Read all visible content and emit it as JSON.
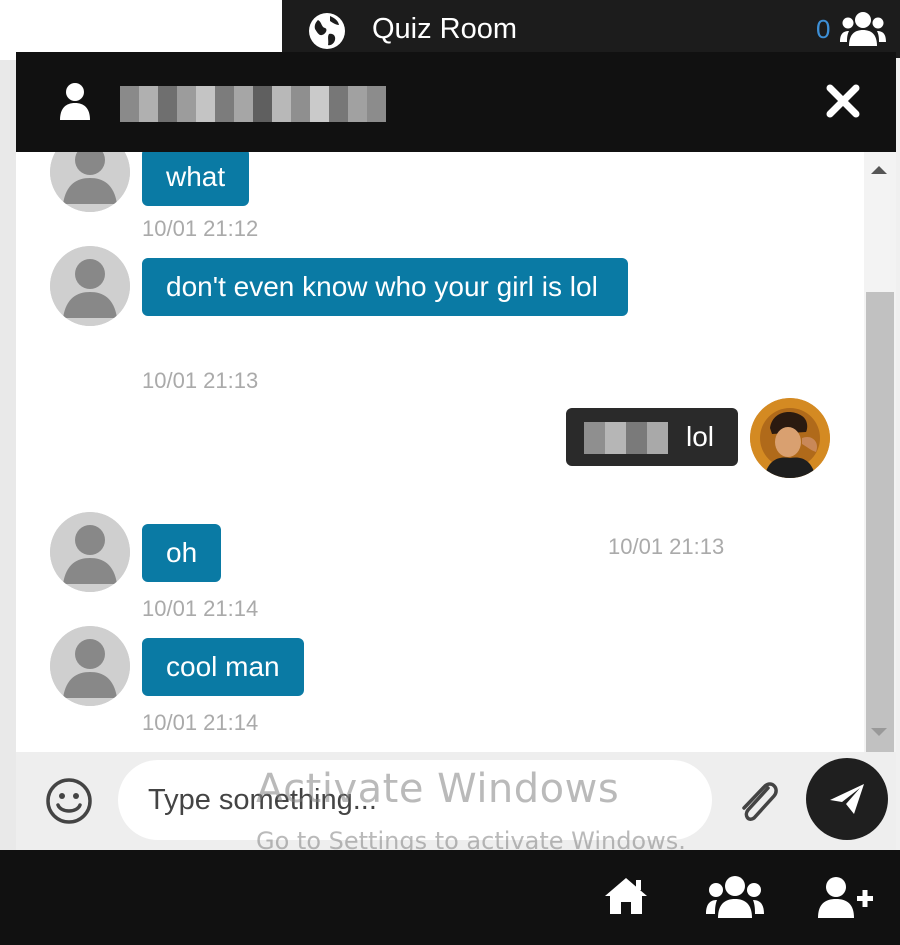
{
  "room": {
    "title": "Quiz Room",
    "online_count": "0",
    "icon": "globe-icon",
    "users_icon": "users-icon"
  },
  "chat": {
    "close_icon": "close-icon",
    "messages": [
      {
        "text": "what",
        "time": "10/01 21:12",
        "mine": false
      },
      {
        "text": "don't even know who your girl is lol",
        "time": "10/01 21:13",
        "mine": false
      },
      {
        "text": "lol",
        "time": "10/01 21:13",
        "mine": true
      },
      {
        "text": "oh",
        "time": "10/01 21:14",
        "mine": false
      },
      {
        "text": "cool man",
        "time": "10/01 21:14",
        "mine": false
      }
    ]
  },
  "composer": {
    "placeholder": "Type something...",
    "emoji_icon": "smiley-icon",
    "attach_icon": "paperclip-icon",
    "send_icon": "paper-plane-icon"
  },
  "watermark": {
    "line1": "Activate Windows",
    "line2": "Go to Settings to activate Windows."
  },
  "bottom_nav": {
    "items": [
      "home-icon",
      "group-icon",
      "add-user-icon"
    ]
  },
  "colors": {
    "incoming_bubble": "#0a7aa4",
    "outgoing_bubble": "#2a2a2a",
    "header": "#111111",
    "accent_count": "#3d8fd6"
  }
}
